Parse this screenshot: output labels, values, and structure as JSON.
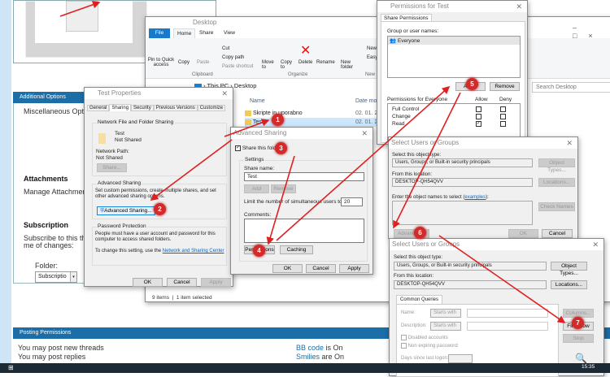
{
  "forum": {
    "additional_options": "Additional Options",
    "misc_options": "Miscellaneous Optio",
    "attachments": "Attachments",
    "manage_attachments": "Manage Attachmen",
    "subscription": "Subscription",
    "subscribe_text1": "Subscribe to this th",
    "subscribe_text2": "me of changes:",
    "folder_label": "Folder:",
    "folder_value": "Subscriptio",
    "posting_permissions": "Posting Permissions",
    "perm_new_threads": "You may post new threads",
    "perm_replies": "You may post replies",
    "bb_code_label": "BB code",
    "bb_code_state": " is On",
    "smilies_label": "Smilies",
    "smilies_state": " are On"
  },
  "explorer": {
    "title": "Desktop",
    "tabs": [
      "File",
      "Home",
      "Share",
      "View"
    ],
    "ribbon": {
      "pin": "Pin to Quick access",
      "copy": "Copy",
      "paste": "Paste",
      "cut": "Cut",
      "copy_path": "Copy path",
      "paste_shortcut": "Paste shortcut",
      "clipboard": "Clipboard",
      "move_to": "Move to",
      "copy_to": "Copy to",
      "delete": "Delete",
      "rename": "Rename",
      "organize": "Organize",
      "new_folder": "New folder",
      "new_item": "New",
      "easy_access": "Easy",
      "new_group": "New"
    },
    "breadcrumb": [
      "This PC",
      "Desktop"
    ],
    "search_placeholder": "Search Desktop",
    "columns": {
      "name": "Name",
      "date": "Date mo"
    },
    "files": [
      {
        "name": "Skripte in uporabno",
        "date": "02. 01. 2"
      },
      {
        "name": "Test",
        "date": "02. 01. 2"
      }
    ],
    "status_items": "9 items",
    "status_selected": "1 item selected"
  },
  "test_properties": {
    "title": "Test Properties",
    "tabs": [
      "General",
      "Sharing",
      "Security",
      "Previous Versions",
      "Customize"
    ],
    "nffs": "Network File and Folder Sharing",
    "folder_name": "Test",
    "folder_state": "Not Shared",
    "network_path_label": "Network Path:",
    "network_path": "Not Shared",
    "share_btn": "Share...",
    "adv_group": "Advanced Sharing",
    "adv_desc": "Set custom permissions, create multiple shares, and set other advanced sharing options.",
    "adv_btn": "Advanced Sharing...",
    "pw_group": "Password Protection",
    "pw_desc": "People must have a user account and password for this computer to access shared folders.",
    "pw_change": "To change this setting, use the ",
    "pw_link": "Network and Sharing Center",
    "ok": "OK",
    "cancel": "Cancel",
    "apply": "Apply"
  },
  "advanced_sharing": {
    "title": "Advanced Sharing",
    "share_checkbox": "Share this folder",
    "settings": "Settings",
    "share_name_label": "Share name:",
    "share_name": "Test",
    "add": "Add",
    "remove": "Remove",
    "limit_label": "Limit the number of simultaneous users to:",
    "limit_value": "20",
    "comments_label": "Comments:",
    "permissions": "Permissions",
    "caching": "Caching",
    "ok": "OK",
    "cancel": "Cancel",
    "apply": "Apply"
  },
  "permissions": {
    "title": "Permissions for Test",
    "tab": "Share Permissions",
    "group_label": "Group or user names:",
    "users": [
      "Everyone"
    ],
    "add": "Add...",
    "remove": "Remove",
    "perm_for": "Permissions for Everyone",
    "allow": "Allow",
    "deny": "Deny",
    "rows": [
      {
        "name": "Full Control",
        "allow": false,
        "deny": false
      },
      {
        "name": "Change",
        "allow": false,
        "deny": false
      },
      {
        "name": "Read",
        "allow": true,
        "deny": false
      }
    ]
  },
  "select_users_1": {
    "title": "Select Users or Groups",
    "obj_type_label": "Select this object type:",
    "obj_type": "Users, Groups, or Built-in security principals",
    "obj_types_btn": "Object Types...",
    "location_label": "From this location:",
    "location": "DESKTOP-QH54QVV",
    "locations_btn": "Locations...",
    "enter_label": "Enter the object names to select (",
    "examples": "examples",
    "enter_label_end": "):",
    "check_names": "Check Names",
    "advanced": "Advanced...",
    "ok": "OK",
    "cancel": "Cancel"
  },
  "select_users_2": {
    "title": "Select Users or Groups",
    "obj_type_label": "Select this object type:",
    "obj_type": "Users, Groups, or Built-in security principals",
    "obj_types_btn": "Object Types...",
    "location_label": "From this location:",
    "location": "DESKTOP-QH54QVV",
    "locations_btn": "Locations...",
    "tab": "Common Queries",
    "name_label": "Name:",
    "desc_label": "Description:",
    "starts_with": "Starts with",
    "disabled": "Disabled accounts",
    "non_expiring": "Non expiring password",
    "days_label": "Days since last logon:",
    "columns": "Columns...",
    "find_now": "Find Now",
    "stop": "Stop"
  },
  "taskbar": {
    "clock": "15:35"
  },
  "badges": [
    "1",
    "2",
    "3",
    "4",
    "5",
    "6",
    "7"
  ],
  "colors": {
    "accent": "#1b6ea8",
    "annotation": "#e02020"
  }
}
